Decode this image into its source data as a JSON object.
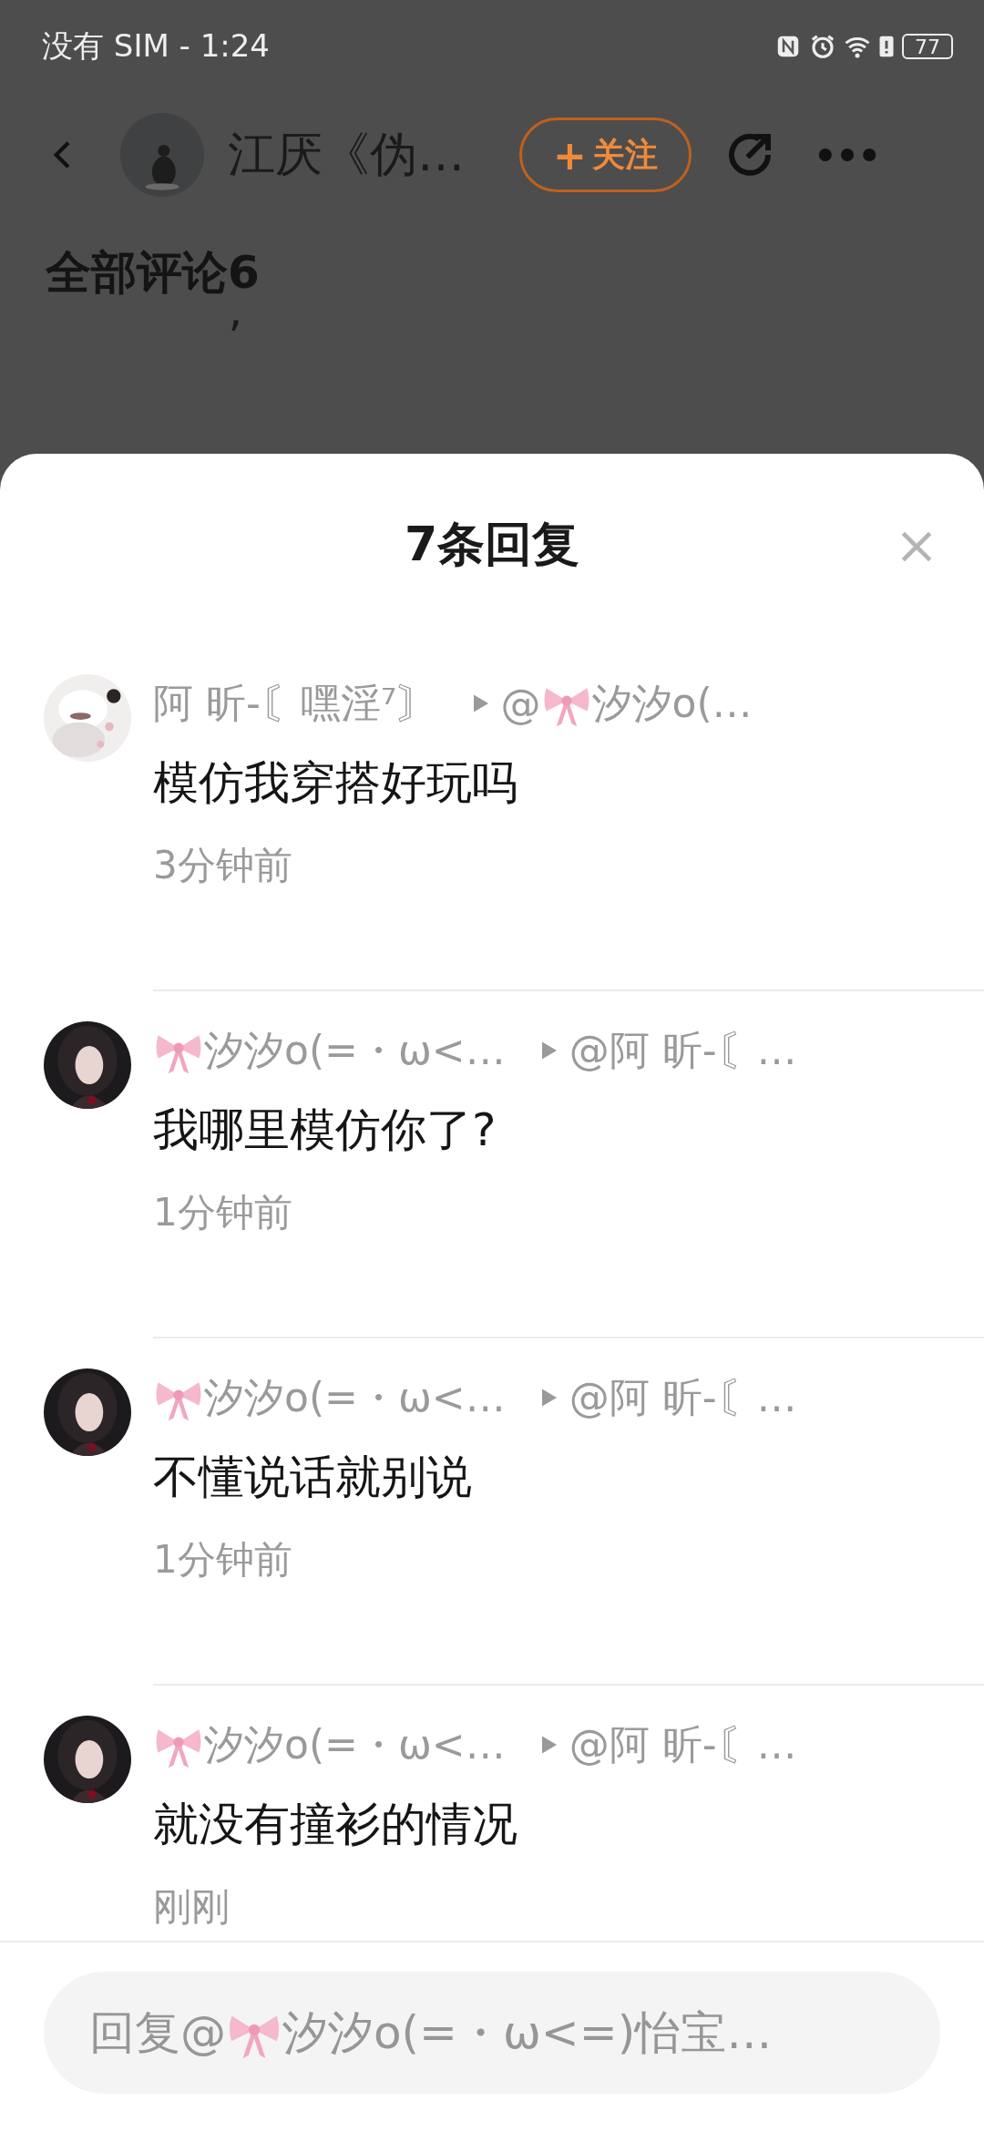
{
  "status_bar": {
    "carrier_time": "没有 SIM - 1:24",
    "battery": "77"
  },
  "header": {
    "title": "江厌《伪…",
    "follow_button": "关注",
    "follow_plus": "+"
  },
  "page": {
    "section_title": "全部评论6",
    "comment_fragment": "ʼ"
  },
  "sheet": {
    "title": "7条回复",
    "replies": [
      {
        "author": [
          {
            "kind": "text",
            "text": "阿 昕-〘嘿淫⁷〙"
          }
        ],
        "target": [
          {
            "kind": "text",
            "text": "@"
          },
          {
            "kind": "bow"
          },
          {
            "kind": "text",
            "text": "汐汐o(…"
          }
        ],
        "content": "模仿我穿搭好玩吗",
        "time": "3分钟前"
      },
      {
        "author": [
          {
            "kind": "bow"
          },
          {
            "kind": "text",
            "text": "汐汐o(=・ω<…"
          }
        ],
        "target": [
          {
            "kind": "text",
            "text": "@阿 昕-〘…"
          }
        ],
        "content": "我哪里模仿你了?",
        "time": "1分钟前"
      },
      {
        "author": [
          {
            "kind": "bow"
          },
          {
            "kind": "text",
            "text": "汐汐o(=・ω<…"
          }
        ],
        "target": [
          {
            "kind": "text",
            "text": "@阿 昕-〘…"
          }
        ],
        "content": "不懂说话就别说",
        "time": "1分钟前"
      },
      {
        "author": [
          {
            "kind": "bow"
          },
          {
            "kind": "text",
            "text": "汐汐o(=・ω<…"
          }
        ],
        "target": [
          {
            "kind": "text",
            "text": "@阿 昕-〘…"
          }
        ],
        "content": "就没有撞衫的情况",
        "time": "刚刚"
      }
    ],
    "reply_field": {
      "placeholder": [
        {
          "kind": "text",
          "text": "回复@"
        },
        {
          "kind": "bow"
        },
        {
          "kind": "text",
          "text": "汐汐o(=・ω<=)怡宝…"
        }
      ]
    }
  }
}
